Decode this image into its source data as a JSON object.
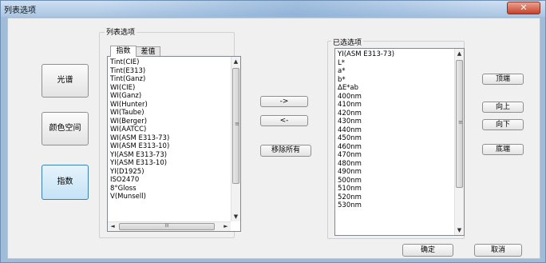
{
  "window": {
    "title": "列表选项",
    "close_glyph": "✕"
  },
  "left_buttons": [
    {
      "label": "光谱"
    },
    {
      "label": "颜色空间"
    },
    {
      "label": "指数"
    }
  ],
  "list_options": {
    "group_label": "列表选项",
    "tabs": [
      {
        "label": "指数"
      },
      {
        "label": "差值"
      }
    ],
    "items": [
      "Tint(CIE)",
      "Tint(E313)",
      "Tint(Ganz)",
      "WI(CIE)",
      "WI(Ganz)",
      "WI(Hunter)",
      "WI(Taube)",
      "WI(Berger)",
      "WI(AATCC)",
      "WI(ASM E313-73)",
      "WI(ASM E313-10)",
      "YI(ASM E313-73)",
      "YI(ASM E313-10)",
      "YI(D1925)",
      "ISO2470",
      "8°Gloss",
      "V(Munsell)"
    ],
    "hscroll_grip": "III"
  },
  "middle_buttons": {
    "add": "->",
    "remove": "<-",
    "remove_all": "移除所有"
  },
  "selected": {
    "group_label": "已选选项",
    "items": [
      "YI(ASM E313-73)",
      "L*",
      "a*",
      "b*",
      "ΔE*ab",
      "400nm",
      "410nm",
      "420nm",
      "430nm",
      "440nm",
      "450nm",
      "460nm",
      "470nm",
      "480nm",
      "490nm",
      "500nm",
      "510nm",
      "520nm",
      "530nm"
    ]
  },
  "right_buttons": {
    "top": "顶端",
    "up": "向上",
    "down": "向下",
    "bottom": "底端"
  },
  "footer": {
    "ok": "确定",
    "cancel": "取消"
  },
  "icons": {
    "scroll_up": "▲",
    "scroll_down": "▼",
    "scroll_left": "◄",
    "scroll_right": "►",
    "grip": "≡"
  }
}
